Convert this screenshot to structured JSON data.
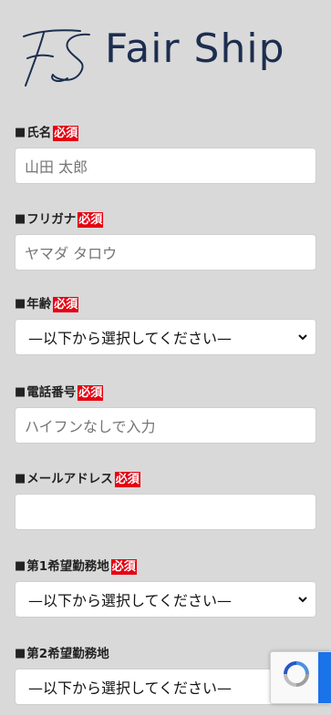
{
  "brand": {
    "monogram": "FS",
    "name": "Fair Ship"
  },
  "required_badge": "必須",
  "fields": [
    {
      "label": "氏名",
      "required": true,
      "type": "text",
      "placeholder": "山田 太郎"
    },
    {
      "label": "フリガナ",
      "required": true,
      "type": "text",
      "placeholder": "ヤマダ タロウ"
    },
    {
      "label": "年齢",
      "required": true,
      "type": "select",
      "value": "—以下から選択してください—"
    },
    {
      "label": "電話番号",
      "required": true,
      "type": "text",
      "placeholder": "ハイフンなしで入力"
    },
    {
      "label": "メールアドレス",
      "required": true,
      "type": "text",
      "placeholder": ""
    },
    {
      "label": "第1希望勤務地",
      "required": true,
      "type": "select",
      "value": "—以下から選択してください—"
    },
    {
      "label": "第2希望勤務地",
      "required": false,
      "type": "select",
      "value": "—以下から選択してください—"
    }
  ],
  "colors": {
    "brand": "#1c2e4f",
    "required": "#e60012",
    "background": "#d9d9d9"
  },
  "icons": {
    "select": "chevron-down-icon",
    "recaptcha": "recaptcha-icon"
  }
}
